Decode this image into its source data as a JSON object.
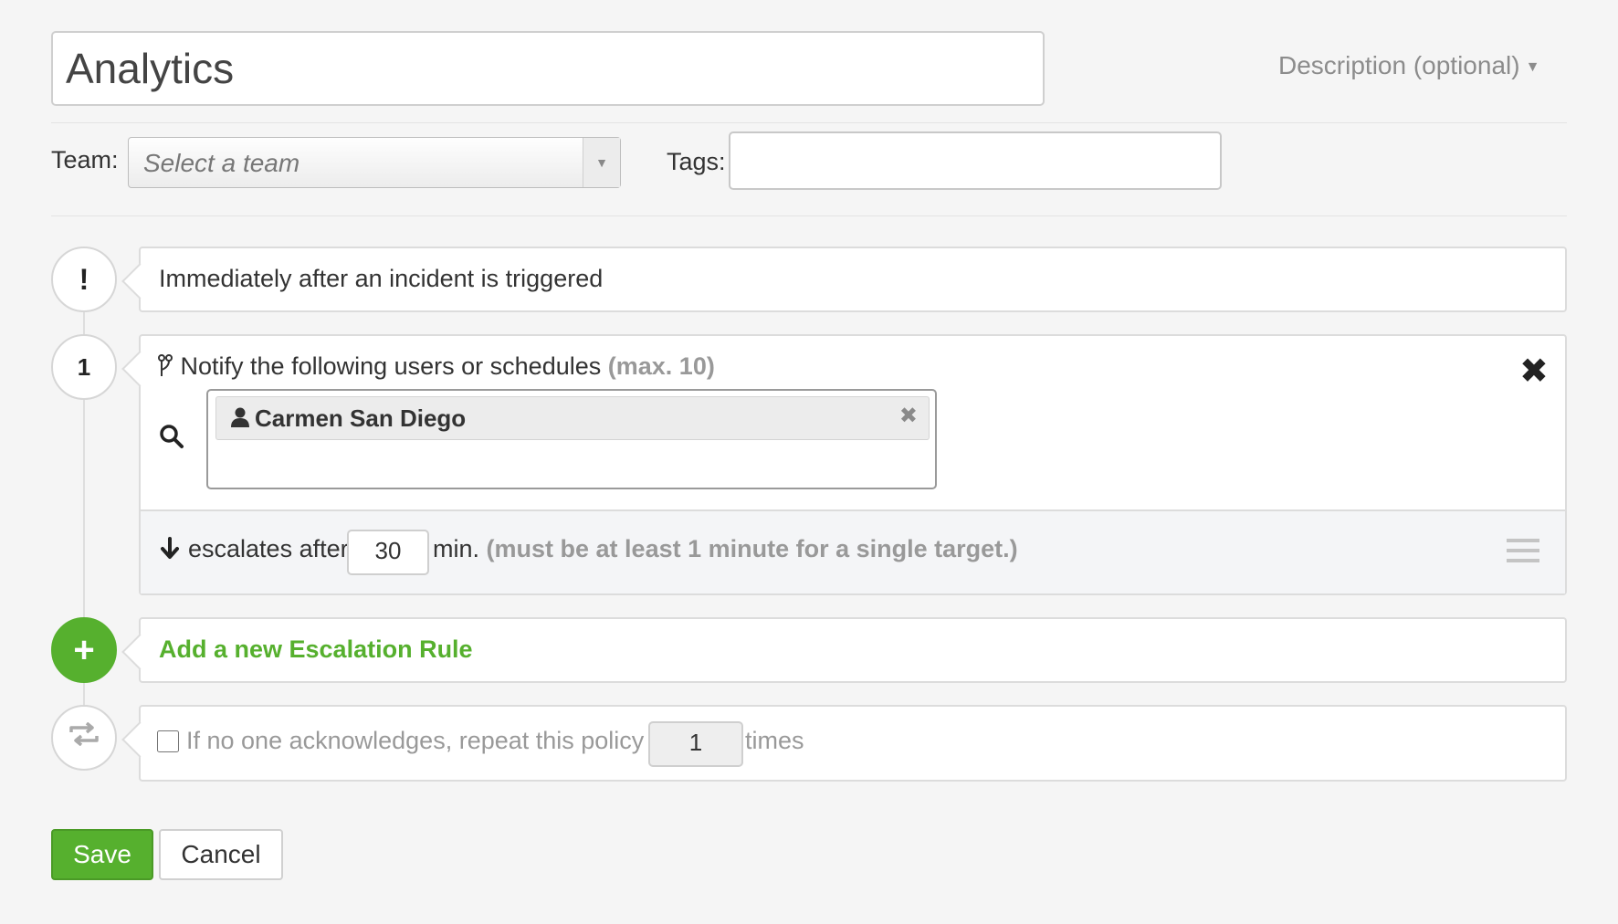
{
  "policy": {
    "name": "Analytics",
    "description_toggle": "Description (optional)"
  },
  "meta": {
    "team_label": "Team:",
    "team_placeholder": "Select a team",
    "tags_label": "Tags:",
    "tags_value": ""
  },
  "trigger": {
    "icon_text": "!",
    "text": "Immediately after an incident is triggered"
  },
  "rules": [
    {
      "number": "1",
      "notify_text": "Notify the following users or schedules",
      "notify_max": "(max. 10)",
      "targets": [
        {
          "name": "Carmen San Diego",
          "icon": "user-icon"
        }
      ],
      "escalate_prefix": "escalates after",
      "escalate_minutes": "30",
      "escalate_unit": "min.",
      "escalate_note": "(must be at least 1 minute for a single target.)"
    }
  ],
  "add_rule": {
    "label": "Add a new Escalation Rule"
  },
  "repeat": {
    "checked": false,
    "prefix": "If no one acknowledges, repeat this policy",
    "count": "1",
    "suffix": "times"
  },
  "actions": {
    "save_label": "Save",
    "cancel_label": "Cancel"
  },
  "colors": {
    "accent_green": "#56b02e",
    "muted_text": "#999999",
    "background": "#f5f5f5"
  }
}
